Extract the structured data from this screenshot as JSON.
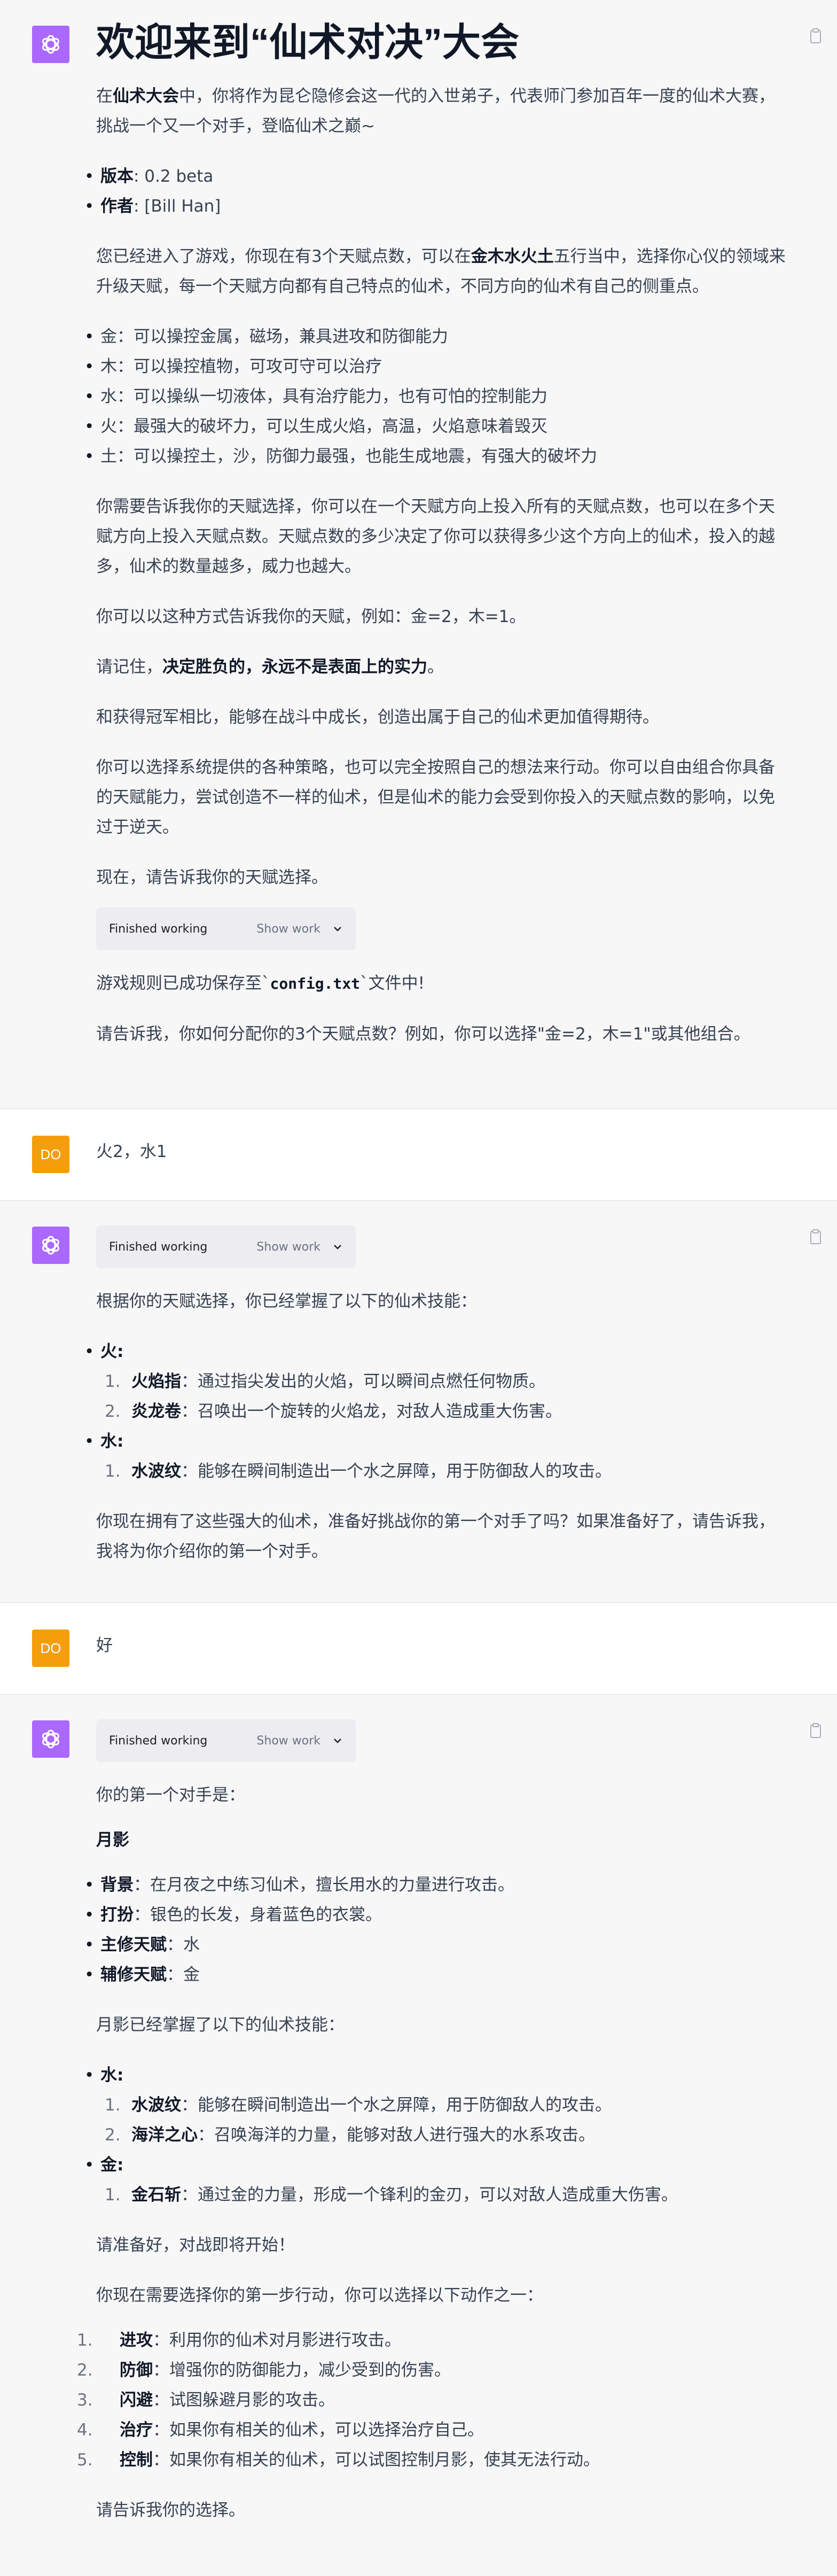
{
  "msg1": {
    "title": "欢迎来到“仙术对决”大会",
    "intro_pre": "在",
    "intro_bold": "仙术大会",
    "intro_post": "中，你将作为昆仑隐修会这一代的入世弟子，代表师门参加百年一度的仙术大赛，挑战一个又一个对手，登临仙术之巅~",
    "version_label": "版本",
    "version_value": ": 0.2 beta",
    "author_label": "作者",
    "author_value": ": [Bill Han]",
    "talent_pre": "您已经进入了游戏，你现在有3个天赋点数，可以在",
    "talent_bold": "金木水火土",
    "talent_post": "五行当中，选择你心仪的领域来升级天赋，每一个天赋方向都有自己特点的仙术，不同方向的仙术有自己的侧重点。",
    "elements": [
      "金：可以操控金属，磁场，兼具进攻和防御能力",
      "木：可以操控植物，可攻可守可以治疗",
      "水：可以操纵一切液体，具有治疗能力，也有可怕的控制能力",
      "火：最强大的破坏力，可以生成火焰，高温，火焰意味着毁灭",
      "土：可以操控土，沙，防御力最强，也能生成地震，有强大的破坏力"
    ],
    "p_allocation": "你需要告诉我你的天赋选择，你可以在一个天赋方向上投入所有的天赋点数，也可以在多个天赋方向上投入天赋点数。天赋点数的多少决定了你可以获得多少这个方向上的仙术，投入的越多，仙术的数量越多，威力也越大。",
    "p_format": "你可以以这种方式告诉我你的天赋，例如：金=2，木=1。",
    "p_remember_pre": "请记住，",
    "p_remember_bold": "决定胜负的，永远不是表面上的实力",
    "p_remember_post": "。",
    "p_growth": "和获得冠军相比，能够在战斗中成长，创造出属于自己的仙术更加值得期待。",
    "p_freedom": "你可以选择系统提供的各种策略，也可以完全按照自己的想法来行动。你可以自由组合你具备的天赋能力，尝试创造不一样的仙术，但是仙术的能力会受到你投入的天赋点数的影响，以免过于逆天。",
    "p_now": "现在，请告诉我你的天赋选择。",
    "working_label": "Finished working",
    "working_show": "Show work",
    "p_saved_pre": "游戏规则已成功保存至`",
    "p_saved_code": "config.txt",
    "p_saved_post": "`文件中!",
    "p_ask": "请告诉我，你如何分配你的3个天赋点数？例如，你可以选择\"金=2，木=1\"或其他组合。"
  },
  "user1": {
    "avatar": "DO",
    "text": "火2，水1"
  },
  "msg2": {
    "working_label": "Finished working",
    "working_show": "Show work",
    "p_intro": "根据你的天赋选择，你已经掌握了以下的仙术技能：",
    "fire_label": "火",
    "fire_skills": [
      {
        "num": "1.",
        "name": "火焰指",
        "desc": "：通过指尖发出的火焰，可以瞬间点燃任何物质。"
      },
      {
        "num": "2.",
        "name": "炎龙卷",
        "desc": "：召唤出一个旋转的火焰龙，对敌人造成重大伤害。"
      }
    ],
    "water_label": "水",
    "water_skills": [
      {
        "num": "1.",
        "name": "水波纹",
        "desc": "：能够在瞬间制造出一个水之屏障，用于防御敌人的攻击。"
      }
    ],
    "p_ready": "你现在拥有了这些强大的仙术，准备好挑战你的第一个对手了吗？如果准备好了，请告诉我，我将为你介绍你的第一个对手。"
  },
  "user2": {
    "avatar": "DO",
    "text": "好"
  },
  "msg3": {
    "working_label": "Finished working",
    "working_show": "Show work",
    "p_first": "你的第一个对手是：",
    "opponent_name": "月影",
    "traits": [
      {
        "label": "背景",
        "value": "：在月夜之中练习仙术，擅长用水的力量进行攻击。"
      },
      {
        "label": "打扮",
        "value": "：银色的长发，身着蓝色的衣裳。"
      },
      {
        "label": "主修天赋",
        "value": "：水"
      },
      {
        "label": "辅修天赋",
        "value": "：金"
      }
    ],
    "p_skills": "月影已经掌握了以下的仙术技能：",
    "water_label": "水",
    "water_skills": [
      {
        "num": "1.",
        "name": "水波纹",
        "desc": "：能够在瞬间制造出一个水之屏障，用于防御敌人的攻击。"
      },
      {
        "num": "2.",
        "name": "海洋之心",
        "desc": "：召唤海洋的力量，能够对敌人进行强大的水系攻击。"
      }
    ],
    "metal_label": "金",
    "metal_skills": [
      {
        "num": "1.",
        "name": "金石斩",
        "desc": "：通过金的力量，形成一个锋利的金刃，可以对敌人造成重大伤害。"
      }
    ],
    "p_prepare": "请准备好，对战即将开始！",
    "p_choose": "你现在需要选择你的第一步行动，你可以选择以下动作之一：",
    "actions": [
      {
        "num": "1.",
        "name": "进攻",
        "desc": "：利用你的仙术对月影进行攻击。"
      },
      {
        "num": "2.",
        "name": "防御",
        "desc": "：增强你的防御能力，减少受到的伤害。"
      },
      {
        "num": "3.",
        "name": "闪避",
        "desc": "：试图躲避月影的攻击。"
      },
      {
        "num": "4.",
        "name": "治疗",
        "desc": "：如果你有相关的仙术，可以选择治疗自己。"
      },
      {
        "num": "5.",
        "name": "控制",
        "desc": "：如果你有相关的仙术，可以试图控制月影，使其无法行动。"
      }
    ],
    "p_tell": "请告诉我你的选择。"
  }
}
